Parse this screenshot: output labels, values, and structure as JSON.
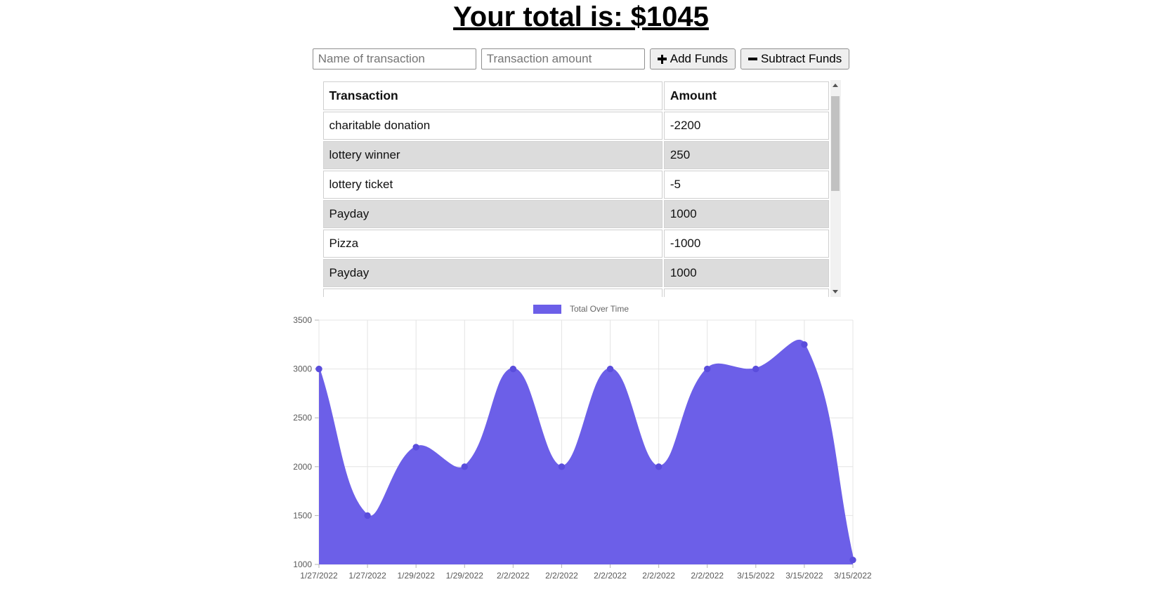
{
  "header": {
    "total_label": "Your total is: $1045"
  },
  "controls": {
    "name_placeholder": "Name of transaction",
    "amount_placeholder": "Transaction amount",
    "add_label": "Add Funds",
    "subtract_label": "Subtract Funds",
    "icons": {
      "add": "plus-icon",
      "subtract": "minus-icon"
    }
  },
  "table": {
    "columns": [
      "Transaction",
      "Amount"
    ],
    "rows": [
      {
        "transaction": "charitable donation",
        "amount": "-2200"
      },
      {
        "transaction": "lottery winner",
        "amount": "250"
      },
      {
        "transaction": "lottery ticket",
        "amount": "-5"
      },
      {
        "transaction": "Payday",
        "amount": "1000"
      },
      {
        "transaction": "Pizza",
        "amount": "-1000"
      },
      {
        "transaction": "Payday",
        "amount": "1000"
      }
    ]
  },
  "chart_data": {
    "type": "area",
    "title": "",
    "legend": "Total Over Time",
    "legend_position": "top",
    "grid": true,
    "x": [
      "1/27/2022",
      "1/27/2022",
      "1/29/2022",
      "1/29/2022",
      "2/2/2022",
      "2/2/2022",
      "2/2/2022",
      "2/2/2022",
      "2/2/2022",
      "3/15/2022",
      "3/15/2022",
      "3/15/2022"
    ],
    "values": [
      3000,
      1500,
      2200,
      2000,
      3000,
      2000,
      3000,
      2000,
      3000,
      3000,
      3250,
      1045
    ],
    "ylim": [
      1000,
      3500
    ],
    "yticks": [
      1000,
      1500,
      2000,
      2500,
      3000,
      3500
    ],
    "xlabel": "",
    "ylabel": "",
    "colors": {
      "accent": "#6C5FE8",
      "point": "#5A4DDC",
      "grid": "#e4e4e4",
      "axis_tick": "#b3b3b3",
      "tick_text": "#595959",
      "legend_text": "#666666"
    }
  }
}
